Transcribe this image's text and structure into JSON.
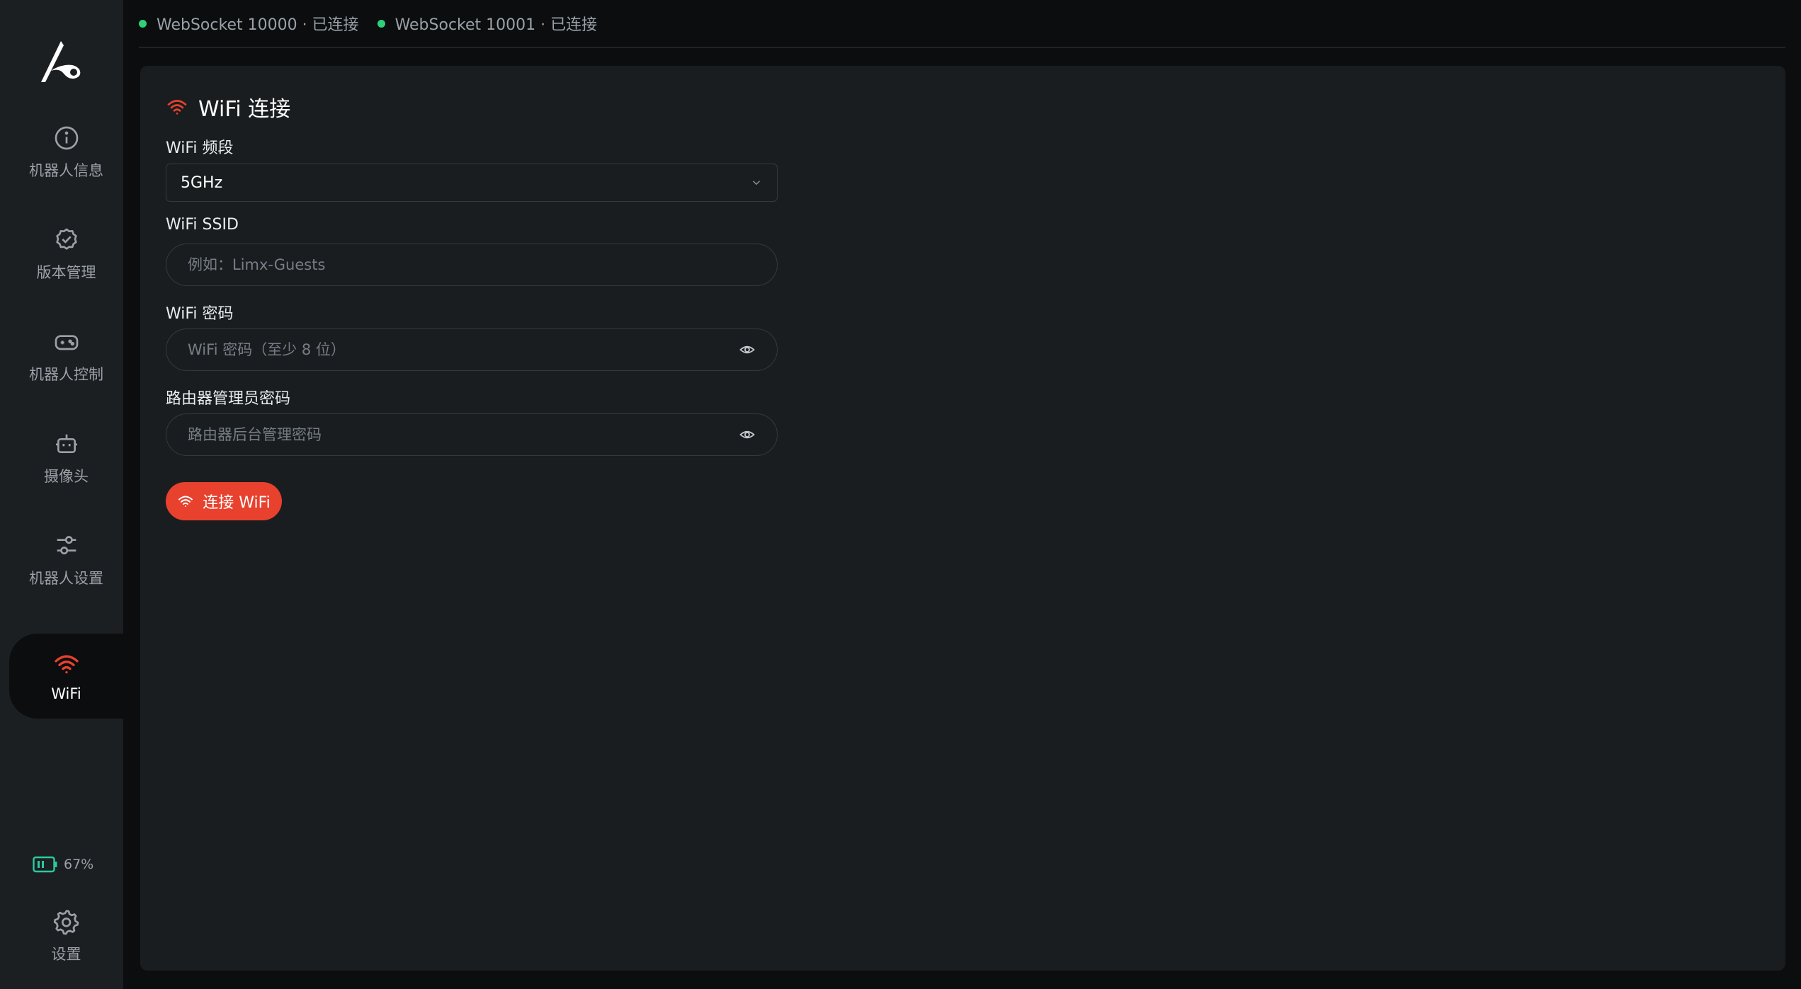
{
  "colors": {
    "accent": "#e8412d",
    "connected": "#2fd07a",
    "battery": "#2bc9a0"
  },
  "sidebar": {
    "items": [
      {
        "label": "机器人信息",
        "icon": "info-icon"
      },
      {
        "label": "版本管理",
        "icon": "badge-check-icon"
      },
      {
        "label": "机器人控制",
        "icon": "gamepad-icon"
      },
      {
        "label": "摄像头",
        "icon": "robot-icon"
      },
      {
        "label": "机器人设置",
        "icon": "sliders-icon"
      },
      {
        "label": "WiFi",
        "icon": "wifi-icon",
        "active": true
      }
    ],
    "battery_level": "67%",
    "settings_label": "设置"
  },
  "status": {
    "ws1": "WebSocket 10000 · 已连接",
    "ws2": "WebSocket 10001 · 已连接"
  },
  "wifi": {
    "title": "WiFi 连接",
    "band_label": "WiFi 频段",
    "band_value": "5GHz",
    "ssid_label": "WiFi SSID",
    "ssid_placeholder": "例如：Limx-Guests",
    "password_label": "WiFi 密码",
    "password_placeholder": "WiFi 密码（至少 8 位）",
    "admin_label": "路由器管理员密码",
    "admin_placeholder": "路由器后台管理密码",
    "connect_label": "连接 WiFi"
  }
}
